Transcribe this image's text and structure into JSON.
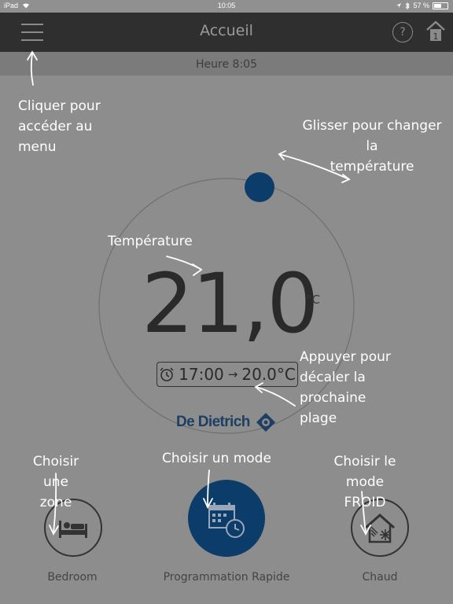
{
  "status_bar": {
    "device": "iPad",
    "time": "10:05",
    "battery": "57 %",
    "battery_level": 0.57
  },
  "header": {
    "title": "Accueil",
    "help_glyph": "?",
    "home_badge": "1"
  },
  "subheader": {
    "time_text": "Heure 8:05"
  },
  "thermostat": {
    "temperature": "21,0",
    "unit": "°C",
    "next_slot": {
      "time": "17:00",
      "arrow": "→",
      "temp": "20.0°C"
    },
    "brand": "De Dietrich"
  },
  "bottom": {
    "zone_label": "Bedroom",
    "mode_label": "Programmation Rapide",
    "heat_label": "Chaud"
  },
  "annotations": {
    "menu": [
      "Cliquer pour",
      "accéder au",
      "menu"
    ],
    "slide": [
      "Glisser pour changer la",
      "température"
    ],
    "temperature": "Température",
    "shift": [
      "Appuyer pour",
      "décaler la",
      "prochaine",
      "plage"
    ],
    "zone": [
      "Choisir une",
      "zone"
    ],
    "mode": "Choisir un mode",
    "cold": [
      "Choisir le mode",
      "FROID"
    ]
  },
  "colors": {
    "background": "#8d8d8d",
    "navbar": "#2f2f2f",
    "accent": "#0c3d6a",
    "annotation": "#ffffff"
  },
  "icons": {
    "menu": "hamburger-icon",
    "help": "help-icon",
    "home": "home-icon",
    "alarm": "alarm-clock-icon",
    "zone": "bed-icon",
    "mode": "calendar-clock-icon",
    "cold": "house-snowflake-icon"
  }
}
